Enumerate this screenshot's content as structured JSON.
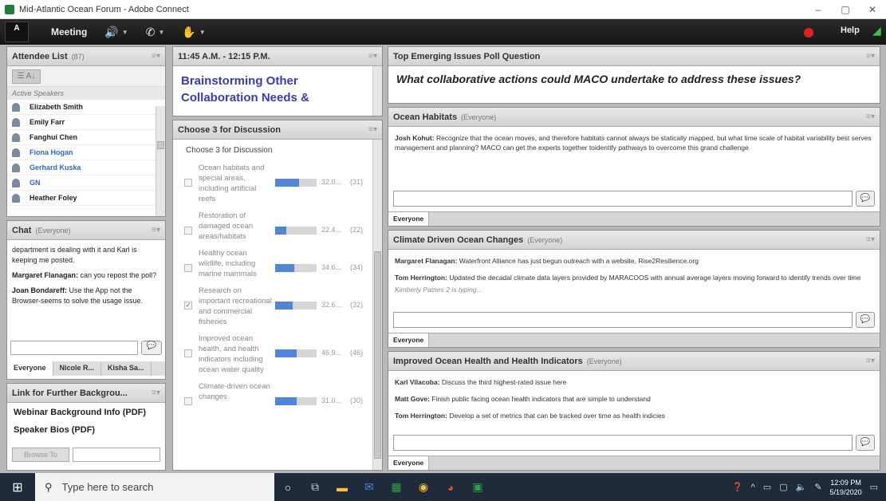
{
  "window": {
    "title": "Mid-Atlantic Ocean Forum - Adobe Connect",
    "controls": [
      "–",
      "▢",
      "✕"
    ]
  },
  "menubar": {
    "logo": "A",
    "meeting": "Meeting",
    "help": "Help"
  },
  "attendees": {
    "title": "Attendee List",
    "count": "(87)",
    "active_speakers": "Active Speakers",
    "people": [
      {
        "name": "Elizabeth Smith",
        "color": "#222222"
      },
      {
        "name": "Emily Farr",
        "color": "#222222"
      },
      {
        "name": "Fanghui Chen",
        "color": "#222222"
      },
      {
        "name": "Fiona Hogan",
        "color": "#2f67c9"
      },
      {
        "name": "Gerhard Kuska",
        "color": "#2f67c9"
      },
      {
        "name": "GN",
        "color": "#2f67c9"
      },
      {
        "name": "Heather Foley",
        "color": "#222222"
      }
    ]
  },
  "chat": {
    "title": "Chat",
    "scope": "(Everyone)",
    "messages": [
      {
        "author": "",
        "text": "department is dealing with it and Karl is keeping me posted."
      },
      {
        "author": "Margaret Flanagan:",
        "text": " can you repost the poll?"
      },
      {
        "author": "Joan Bondareff:",
        "text": " Use the App not the Browser-seems to solve the usage issue."
      }
    ],
    "tabs": [
      "Everyone",
      "Nicole R...",
      "Kisha Sa..."
    ]
  },
  "links": {
    "title": "Link for Further Backgrou...",
    "items": [
      "Webinar Background Info (PDF)",
      "Speaker Bios (PDF)"
    ],
    "browse_label": "Browse To"
  },
  "agenda": {
    "time": "11:45 A.M. - 12:15 P.M.",
    "title_line1": "Brainstorming Other",
    "title_line2": "Collaboration Needs &"
  },
  "poll": {
    "header": "Choose 3 for Discussion",
    "question": "Choose 3 for Discussion",
    "options": [
      {
        "label": "Ocean habitats and special areas, including artificial reefs",
        "pct": "32.0...",
        "count": "(31)",
        "fill": 0.58,
        "checked": false
      },
      {
        "label": "Restoration of damaged ocean areas/habitats",
        "pct": "22.4...",
        "count": "(22)",
        "fill": 0.26,
        "checked": false
      },
      {
        "label": "Healthy ocean wildlife, including marine mammals",
        "pct": "34.6...",
        "count": "(34)",
        "fill": 0.46,
        "checked": false
      },
      {
        "label": "Research on important recreational and commercial fisheries",
        "pct": "32.6...",
        "count": "(32)",
        "fill": 0.42,
        "checked": true
      },
      {
        "label": "Improved ocean health, and health indicators including ocean water quality",
        "pct": "46.9...",
        "count": "(46)",
        "fill": 0.52,
        "checked": false
      },
      {
        "label": "Climate-driven ocean changes",
        "pct": "31.0...",
        "count": "(30)",
        "fill": 0.52,
        "checked": false
      }
    ]
  },
  "top_issues": {
    "title": "Top Emerging Issues Poll Question",
    "question": "What collaborative actions could MACO undertake to address these issues?"
  },
  "habitats": {
    "title": "Ocean Habitats",
    "scope": "(Everyone)",
    "entries": [
      {
        "author": "Josh Kohut:",
        "text": " Recognize that the ocean moves, and therefore habitats cannot always be statically mapped, but what time scale of habitat variability best serves management and planning? MACO can get the experts together toidentify pathways to overcome this grand challenge"
      }
    ],
    "footer": "Everyone"
  },
  "climate": {
    "title": "Climate Driven Ocean Changes",
    "scope": "(Everyone)",
    "entries": [
      {
        "author": "Margaret Flanagan:",
        "text": " Waterfront Alliance has just begun outreach with a website, Rise2Resilience.org"
      },
      {
        "author": "Tom Herrington:",
        "text": " Updated the decadal climate data layers provided by MARACOOS with annual average layers moving forward to identify trends over time"
      }
    ],
    "typing": "Kimberly Patnes 2 is typing...",
    "footer": "Everyone"
  },
  "health": {
    "title": "Improved Ocean Health and Health Indicators",
    "scope": "(Everyone)",
    "entries": [
      {
        "author": "Karl Vilacoba:",
        "text": " Discuss the third highest-rated issue here"
      },
      {
        "author": "Matt Gove:",
        "text": " Finish public facing ocean health indicators that are simple to understand"
      },
      {
        "author": "Tom Herrington:",
        "text": " Develop a set of metrics that can be tracked over time as health indicies"
      }
    ],
    "footer": "Everyone"
  },
  "taskbar": {
    "search_placeholder": "Type here to search",
    "time": "12:09 PM",
    "date": "5/19/2020"
  }
}
